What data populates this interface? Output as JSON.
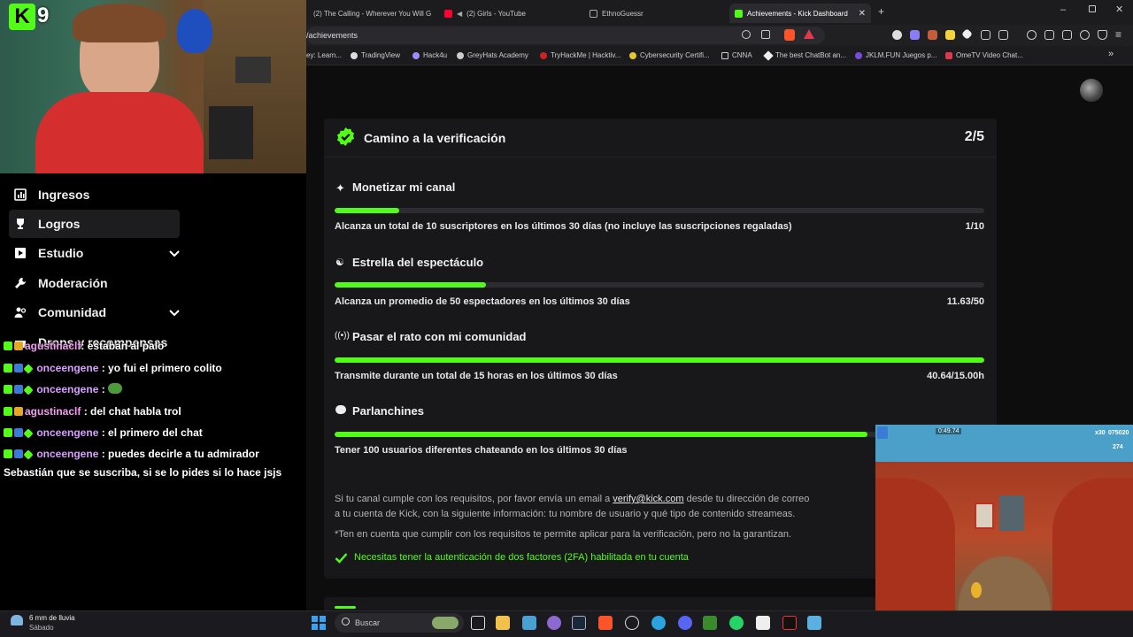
{
  "browser": {
    "tabs": [
      {
        "label": "(2) The Calling - Wherever You Will G",
        "icon": "youtube-icon",
        "active": false
      },
      {
        "label": "(2) Girls - YouTube",
        "icon": "youtube-icon",
        "active": false
      },
      {
        "label": "EthnoGuessr",
        "icon": "page-icon",
        "active": false
      },
      {
        "label": "Achievements - Kick Dashboard",
        "icon": "kick-icon",
        "active": true
      }
    ],
    "new_tab_label": "+",
    "address": "/achievements",
    "bookmarks": [
      "ey: Learn...",
      "TradingView",
      "Hack4u",
      "GreyHats Academy",
      "TryHackMe | Hacktiv...",
      "Cybersecurity Certifi...",
      "CNNA",
      "The best ChatBot an...",
      "JKLM.FUN Juegos p...",
      "OmeTV Video Chat..."
    ],
    "bookmarks_more": "»"
  },
  "stream_overlay": {
    "channel_number": "9"
  },
  "sidebar": {
    "items": [
      {
        "label": "Ingresos",
        "icon": "bar-chart-icon",
        "expandable": false,
        "selected": false
      },
      {
        "label": "Logros",
        "icon": "trophy-icon",
        "expandable": false,
        "selected": true
      },
      {
        "label": "Estudio",
        "icon": "video-icon",
        "expandable": true,
        "selected": false
      },
      {
        "label": "Moderación",
        "icon": "wrench-icon",
        "expandable": false,
        "selected": false
      },
      {
        "label": "Comunidad",
        "icon": "people-icon",
        "expandable": true,
        "selected": false
      },
      {
        "label": "Drops y recompensas",
        "icon": "gift-icon",
        "expandable": false,
        "selected": false
      }
    ]
  },
  "chat": [
    {
      "user": "agustinaclf",
      "text": ": estaban al palo"
    },
    {
      "user": "onceengene",
      "text": ": yo fui el primero colito"
    },
    {
      "user": "onceengene",
      "text": ":"
    },
    {
      "user": "agustinaclf",
      "text": ": del chat habla trol"
    },
    {
      "user": "onceengene",
      "text": ": el primero del chat"
    },
    {
      "user": "onceengene",
      "text": ": puedes decirle a tu admirador"
    },
    {
      "user": "",
      "text": "Sebastián que se suscriba, si se lo pides si lo hace jsjs"
    }
  ],
  "verification": {
    "title": "Camino a la verificación",
    "progress": "2/5",
    "achievements": [
      {
        "title": "Monetizar mi canal",
        "icon": "sparkle-icon",
        "description": "Alcanza un total de 10 suscriptores en los últimos 30 días (no incluye las suscripciones regaladas)",
        "value": "1/10",
        "fraction": 0.1
      },
      {
        "title": "Estrella del espectáculo",
        "icon": "users-icon",
        "description": "Alcanza un promedio de 50 espectadores en los últimos 30 días",
        "value": "11.63/50",
        "fraction": 0.233
      },
      {
        "title": "Pasar el rato con mi comunidad",
        "icon": "broadcast-icon",
        "description": "Transmite durante un total de 15 horas en los últimos 30 días",
        "value": "40.64/15.00h",
        "fraction": 1.0
      },
      {
        "title": "Parlanchines",
        "icon": "chat-bubble-icon",
        "description": "Tener 100 usuarios diferentes chateando en los últimos 30 días",
        "value": "",
        "fraction": 0.82
      }
    ],
    "note_before_link": "Si tu canal cumple con los requisitos, por favor envía un email a ",
    "note_link": "verify@kick.com",
    "note_after_link": " desde tu dirección de correo",
    "note_line2": "a tu cuenta de Kick, con la siguiente información: tu nombre de usuario y qué tipo de contenido streameas.",
    "disclaimer": "*Ten en cuenta que cumplir con los requisitos te permite aplicar para la verificación, pero no la garantizan.",
    "twofa": "Necesitas tener la autenticación de dos factores (2FA) habilitada en tu cuenta"
  },
  "game_hud": {
    "multiplier": "x30",
    "score": "075020",
    "coins": "274",
    "timer": "0:49.74"
  },
  "taskbar": {
    "weather_main": "6 mm de lluvia",
    "weather_sub": "Sábado",
    "search_placeholder": "Buscar"
  },
  "colors": {
    "accent": "#53fc18",
    "card": "#18181b",
    "background": "#0d0d0e"
  }
}
